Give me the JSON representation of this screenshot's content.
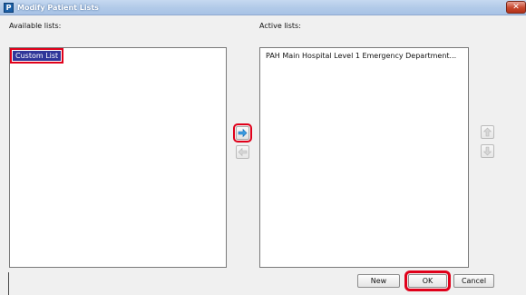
{
  "window": {
    "title": "Modify Patient Lists",
    "app_icon_letter": "P",
    "close_glyph": "✕"
  },
  "available": {
    "label": "Available lists:",
    "items": [
      {
        "label": "Custom List",
        "selected": true
      }
    ]
  },
  "active": {
    "label": "Active lists:",
    "items": [
      {
        "label": "PAH Main Hospital Level 1 Emergency Department...",
        "selected": false
      }
    ]
  },
  "transfer": {
    "move_right_icon": "arrow-right-icon",
    "move_left_icon": "arrow-left-icon",
    "move_right_enabled": true,
    "move_left_enabled": false
  },
  "order": {
    "move_up_icon": "arrow-up-icon",
    "move_down_icon": "arrow-down-icon",
    "move_up_enabled": false,
    "move_down_enabled": false
  },
  "buttons": {
    "new_label": "New",
    "ok_label": "OK",
    "cancel_label": "Cancel"
  },
  "colors": {
    "selection": "#2f3699",
    "highlight_annotation": "#e0001a",
    "title_gradient": "#b3cbe9"
  }
}
